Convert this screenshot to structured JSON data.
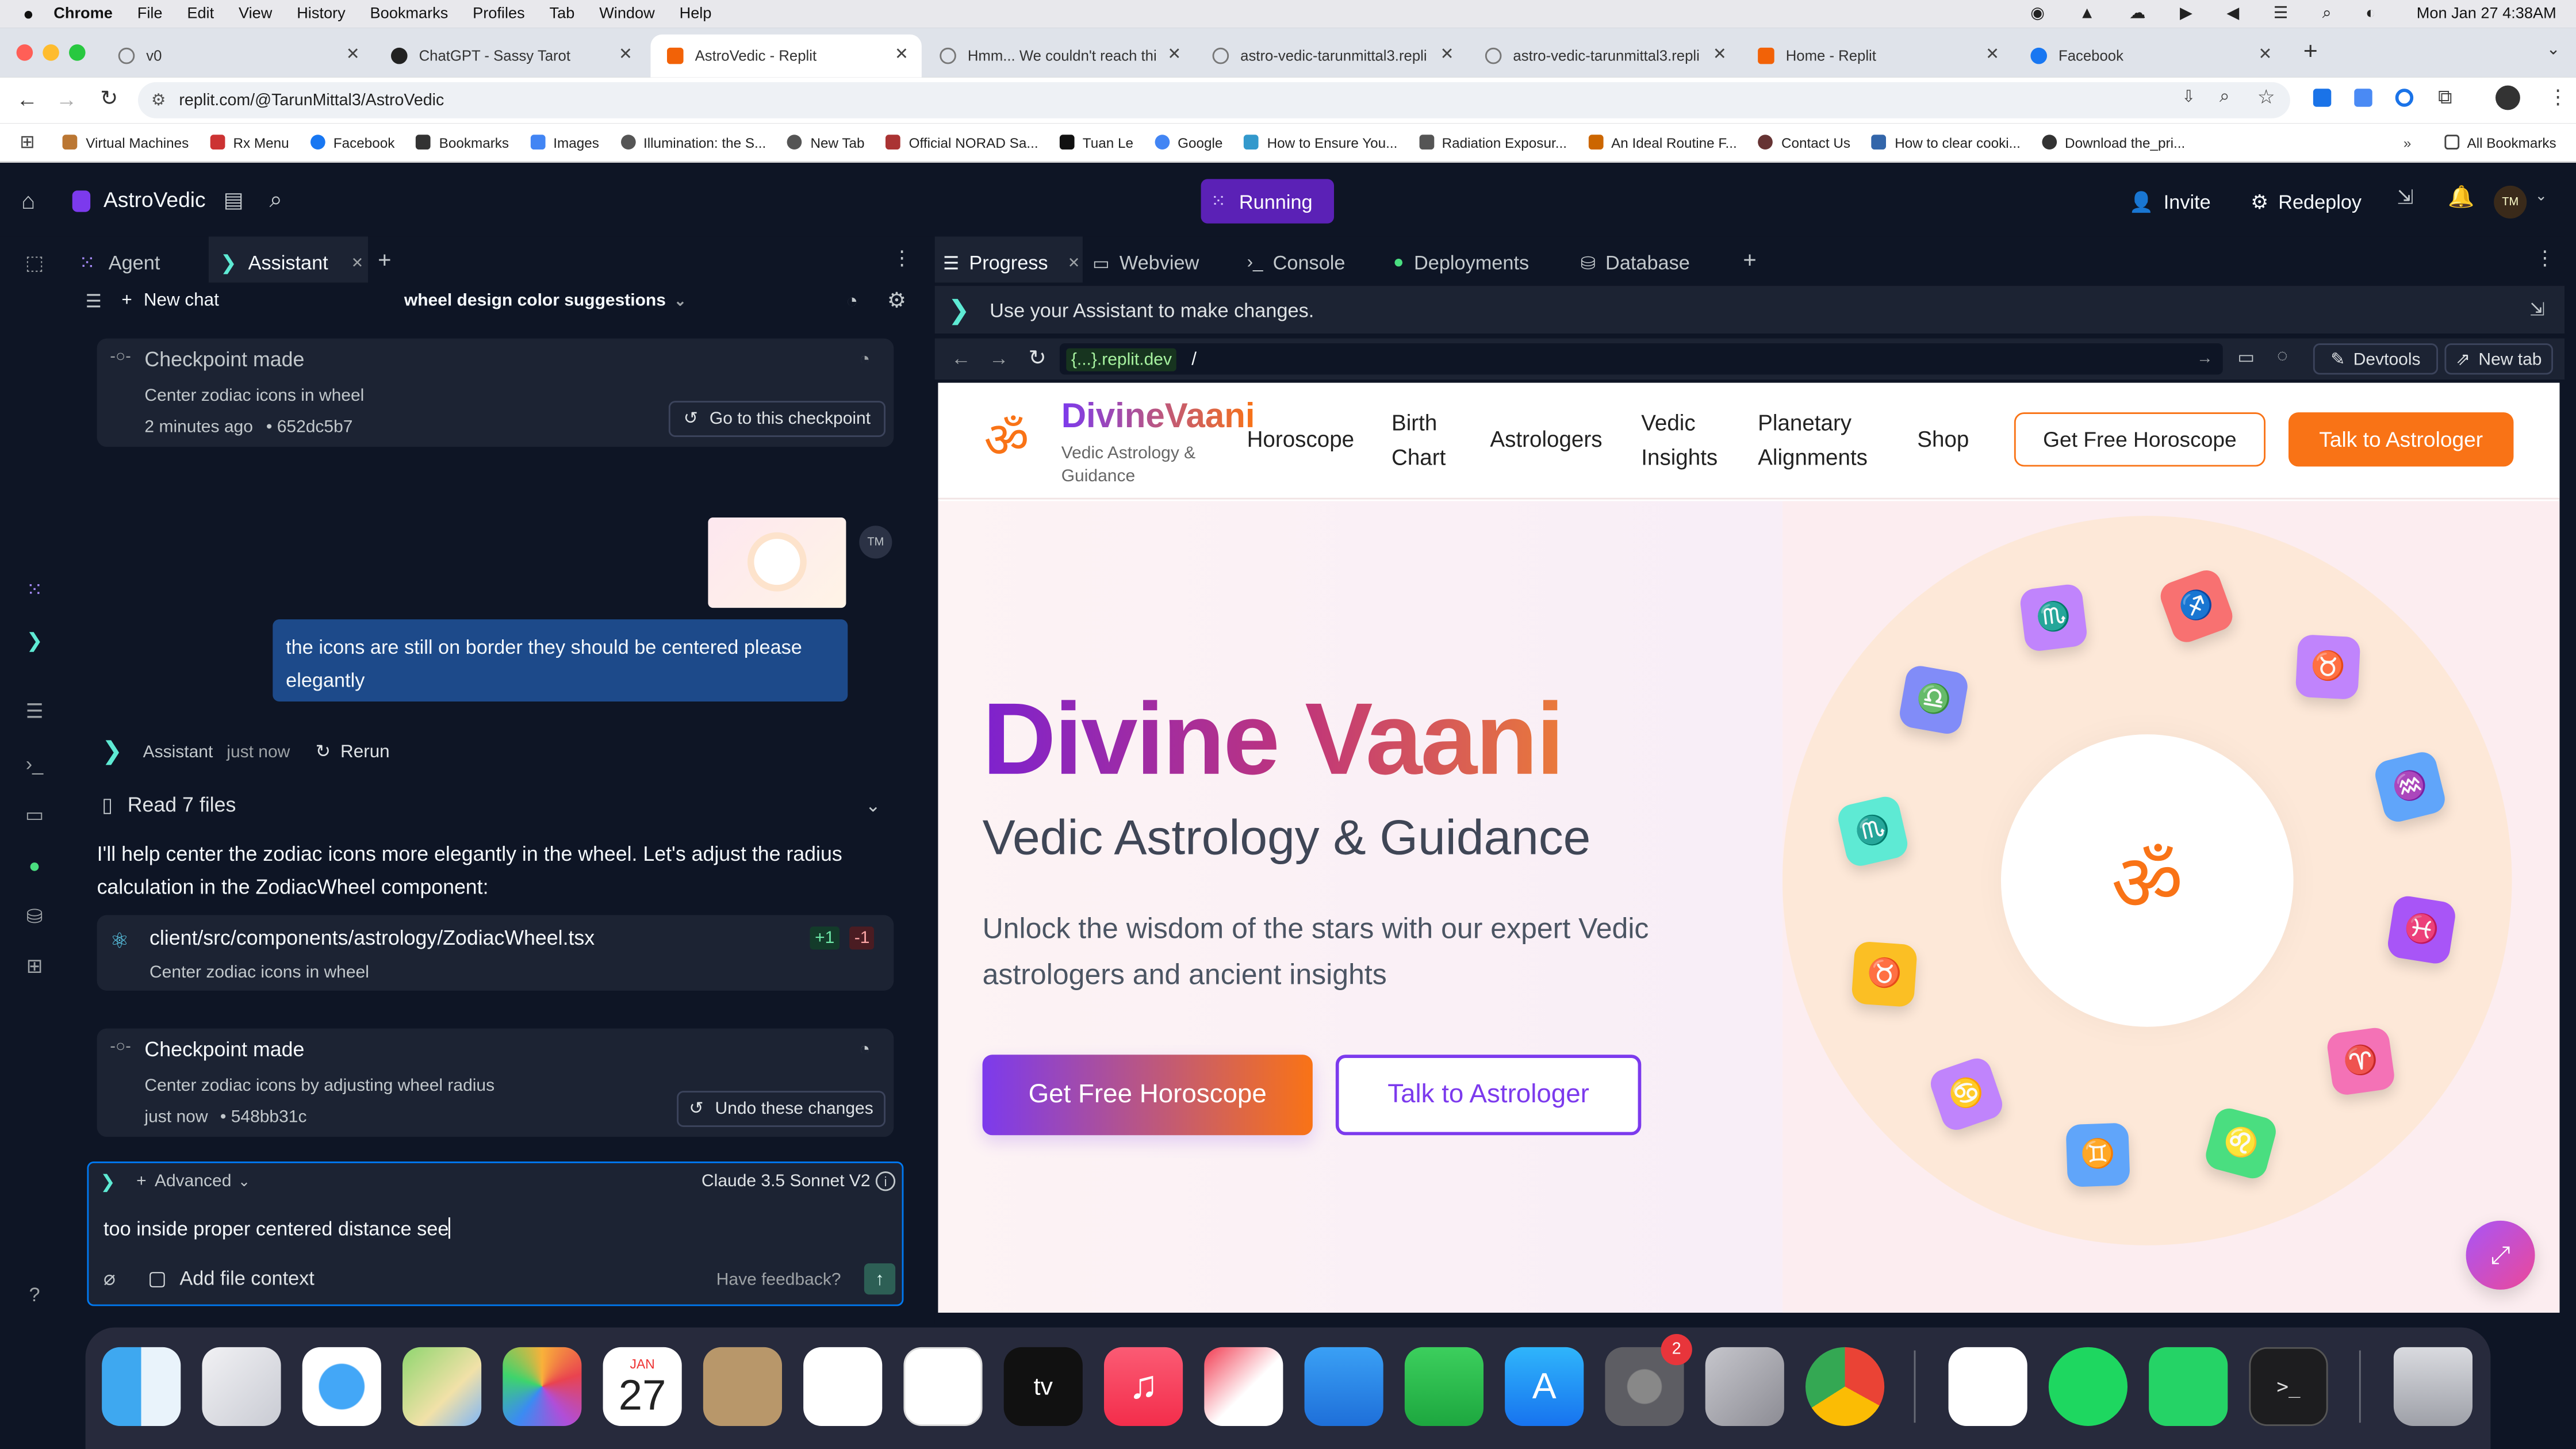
{
  "menubar": {
    "app": "Chrome",
    "items": [
      "File",
      "Edit",
      "View",
      "History",
      "Bookmarks",
      "Profiles",
      "Tab",
      "Window",
      "Help"
    ],
    "clock": "Mon Jan 27  4:38AM"
  },
  "tabs": [
    {
      "title": "v0",
      "color": "#777"
    },
    {
      "title": "ChatGPT - Sassy Tarot",
      "color": "#222"
    },
    {
      "title": "AstroVedic - Replit",
      "color": "#f26207"
    },
    {
      "title": "Hmm... We couldn't reach thi",
      "color": "#777"
    },
    {
      "title": "astro-vedic-tarunmittal3.repli",
      "color": "#777"
    },
    {
      "title": "astro-vedic-tarunmittal3.repli",
      "color": "#777"
    },
    {
      "title": "Home - Replit",
      "color": "#f26207"
    },
    {
      "title": "Facebook",
      "color": "#1877f2"
    }
  ],
  "address": {
    "url": "replit.com/@TarunMittal3/AstroVedic"
  },
  "bookmarks": [
    {
      "label": "Virtual Machines",
      "color": "#b73"
    },
    {
      "label": "Rx Menu",
      "color": "#c33"
    },
    {
      "label": "Facebook",
      "color": "#1877f2"
    },
    {
      "label": "Bookmarks",
      "color": "#333"
    },
    {
      "label": "Images",
      "color": "#4285f4"
    },
    {
      "label": "Illumination: the S...",
      "color": "#555"
    },
    {
      "label": "New Tab",
      "color": "#555"
    },
    {
      "label": "Official NORAD Sa...",
      "color": "#a33"
    },
    {
      "label": "Tuan Le",
      "color": "#111"
    },
    {
      "label": "Google",
      "color": "#4285f4"
    },
    {
      "label": "How to Ensure You...",
      "color": "#39c"
    },
    {
      "label": "Radiation Exposur...",
      "color": "#555"
    },
    {
      "label": "An Ideal Routine F...",
      "color": "#c60"
    },
    {
      "label": "Contact Us",
      "color": "#633"
    },
    {
      "label": "How to clear cooki...",
      "color": "#36a"
    },
    {
      "label": "Download the_pri...",
      "color": "#333"
    }
  ],
  "all_bookmarks": "All Bookmarks",
  "replit": {
    "project": "AstroVedic",
    "status": "Running",
    "invite": "Invite",
    "redeploy": "Redeploy",
    "avatar": "TM",
    "left_tabs": {
      "agent": "Agent",
      "assistant": "Assistant"
    },
    "new_chat": "New chat",
    "chat_title": "wheel design color suggestions",
    "checkpoint1": {
      "title": "Checkpoint made",
      "desc": "Center zodiac icons in wheel",
      "meta": "2 minutes ago",
      "hash": "652dc5b7",
      "button": "Go to this checkpoint"
    },
    "user_msg": "the icons are still on border they should be centered please elegantly",
    "user_avatar": "TM",
    "assistant": {
      "name": "Assistant",
      "time": "just now",
      "rerun": "Rerun"
    },
    "read_files": "Read 7 files",
    "reply": "I'll help center the zodiac icons more elegantly in the wheel. Let's adjust the radius calculation in the ZodiacWheel component:",
    "file": {
      "path": "client/src/components/astrology/ZodiacWheel.tsx",
      "plus": "+1",
      "minus": "-1",
      "desc": "Center zodiac icons in wheel"
    },
    "checkpoint2": {
      "title": "Checkpoint made",
      "desc": "Center zodiac icons by adjusting wheel radius",
      "meta": "just now",
      "hash": "548bb31c",
      "button": "Undo these changes"
    },
    "composer": {
      "advanced": "Advanced",
      "model": "Claude 3.5 Sonnet V2",
      "text": "too inside proper centered distance see",
      "add_context": "Add file context",
      "feedback": "Have feedback?"
    },
    "right_tabs": [
      "Progress",
      "Webview",
      "Console",
      "Deployments",
      "Database"
    ],
    "hint": "Use your Assistant to make changes.",
    "preview_url": {
      "host": "{...}.replit.dev",
      "path": "/"
    },
    "devtools": "Devtools",
    "newtab": "New tab"
  },
  "site": {
    "brand": "DivineVaani",
    "tagline": "Vedic Astrology & Guidance",
    "logo_glyph": "ॐ",
    "nav": [
      "Horoscope",
      "Birth Chart",
      "Astrologers",
      "Vedic Insights",
      "Planetary Alignments",
      "Shop"
    ],
    "nav_cta1": "Get Free Horoscope",
    "nav_cta2": "Talk to Astrologer",
    "hero_title": "Divine Vaani",
    "hero_sub": "Vedic Astrology & Guidance",
    "hero_text": "Unlock the wisdom of the stars with our expert Vedic astrologers and ancient insights",
    "cta1": "Get Free Horoscope",
    "cta2": "Talk to Astrologer",
    "wheel_center": "ॐ",
    "zodiac": [
      {
        "glyph": "♐",
        "color": "#f87171"
      },
      {
        "glyph": "♉",
        "color": "#c084fc"
      },
      {
        "glyph": "♒",
        "color": "#60a5fa"
      },
      {
        "glyph": "♓",
        "color": "#a855f7"
      },
      {
        "glyph": "♈",
        "color": "#f472b6"
      },
      {
        "glyph": "♌",
        "color": "#4ade80"
      },
      {
        "glyph": "♊",
        "color": "#60a5fa"
      },
      {
        "glyph": "♋",
        "color": "#c084fc"
      },
      {
        "glyph": "♉",
        "color": "#fbbf24"
      },
      {
        "glyph": "♏",
        "color": "#5eead4"
      },
      {
        "glyph": "♎",
        "color": "#818cf8"
      },
      {
        "glyph": "♏",
        "color": "#c084fc"
      }
    ]
  },
  "dock": {
    "badge": "2",
    "calendar_month": "JAN",
    "calendar_day": "27"
  }
}
